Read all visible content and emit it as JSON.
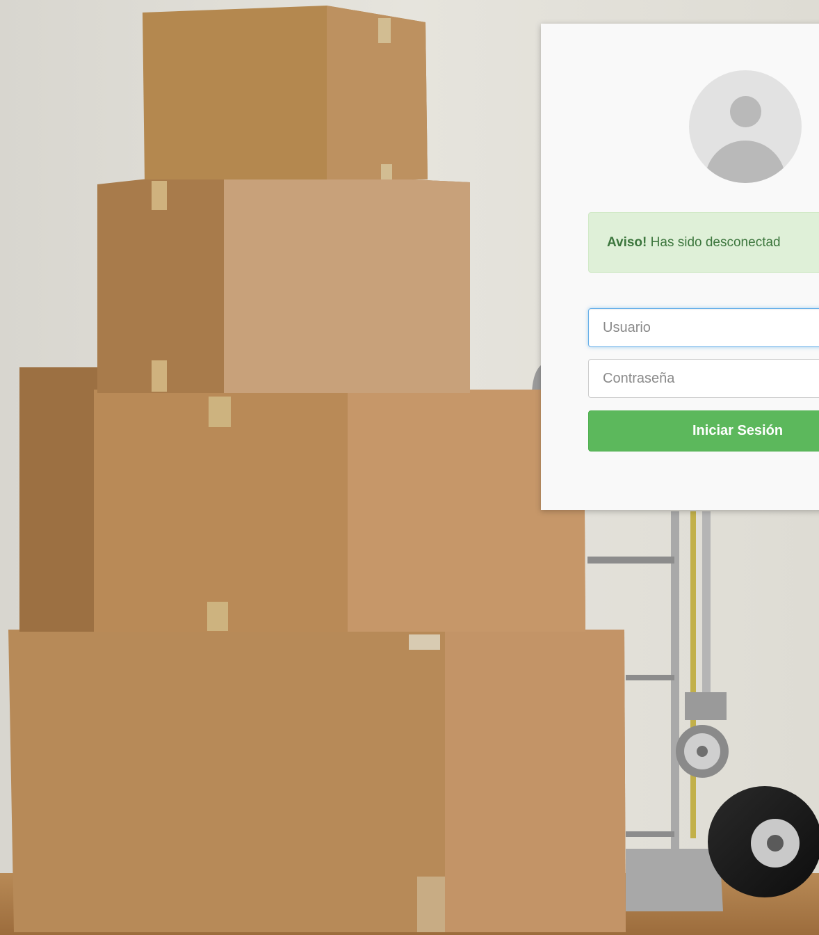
{
  "background": {
    "description_icon": "cardboard-boxes-hand-truck-photo"
  },
  "login": {
    "avatar_icon": "default-user-avatar-icon",
    "alert": {
      "strong": "Aviso!",
      "message": "Has sido desconectad"
    },
    "username_placeholder": "Usuario",
    "password_placeholder": "Contraseña",
    "submit_label": "Iniciar Sesión"
  },
  "colors": {
    "alert_bg": "#dff0d8",
    "alert_text": "#3c763d",
    "button_bg": "#5cb85c",
    "focus_border": "#66afe9"
  }
}
